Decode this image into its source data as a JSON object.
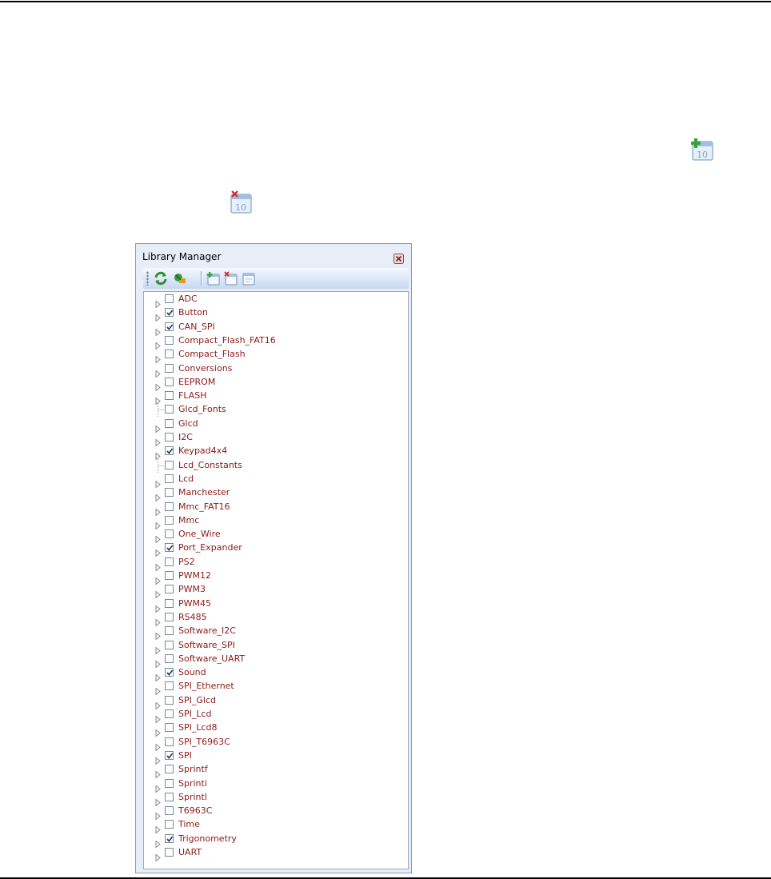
{
  "window": {
    "title": "Library Manager"
  },
  "toolbar": {
    "buttons": [
      {
        "name": "refresh-icon"
      },
      {
        "name": "rebuild-icon"
      },
      {
        "name": "check-all-icon"
      },
      {
        "name": "clear-all-icon"
      },
      {
        "name": "restore-default-icon"
      }
    ]
  },
  "page_icons": [
    {
      "name": "check-all-libraries-icon"
    },
    {
      "name": "clear-all-libraries-icon"
    }
  ],
  "libraries": [
    {
      "label": "ADC",
      "checked": false,
      "expandable": true
    },
    {
      "label": "Button",
      "checked": true,
      "expandable": true
    },
    {
      "label": "CAN_SPI",
      "checked": true,
      "expandable": true
    },
    {
      "label": "Compact_Flash_FAT16",
      "checked": false,
      "expandable": true
    },
    {
      "label": "Compact_Flash",
      "checked": false,
      "expandable": true
    },
    {
      "label": "Conversions",
      "checked": false,
      "expandable": true
    },
    {
      "label": "EEPROM",
      "checked": false,
      "expandable": true
    },
    {
      "label": "FLASH",
      "checked": false,
      "expandable": true
    },
    {
      "label": "Glcd_Fonts",
      "checked": false,
      "expandable": false
    },
    {
      "label": "Glcd",
      "checked": false,
      "expandable": true
    },
    {
      "label": "I2C",
      "checked": false,
      "expandable": true
    },
    {
      "label": "Keypad4x4",
      "checked": true,
      "expandable": true
    },
    {
      "label": "Lcd_Constants",
      "checked": false,
      "expandable": false
    },
    {
      "label": "Lcd",
      "checked": false,
      "expandable": true
    },
    {
      "label": "Manchester",
      "checked": false,
      "expandable": true
    },
    {
      "label": "Mmc_FAT16",
      "checked": false,
      "expandable": true
    },
    {
      "label": "Mmc",
      "checked": false,
      "expandable": true
    },
    {
      "label": "One_Wire",
      "checked": false,
      "expandable": true
    },
    {
      "label": "Port_Expander",
      "checked": true,
      "expandable": true
    },
    {
      "label": "PS2",
      "checked": false,
      "expandable": true
    },
    {
      "label": "PWM12",
      "checked": false,
      "expandable": true
    },
    {
      "label": "PWM3",
      "checked": false,
      "expandable": true
    },
    {
      "label": "PWM45",
      "checked": false,
      "expandable": true
    },
    {
      "label": "RS485",
      "checked": false,
      "expandable": true
    },
    {
      "label": "Software_I2C",
      "checked": false,
      "expandable": true
    },
    {
      "label": "Software_SPI",
      "checked": false,
      "expandable": true
    },
    {
      "label": "Software_UART",
      "checked": false,
      "expandable": true
    },
    {
      "label": "Sound",
      "checked": true,
      "expandable": true
    },
    {
      "label": "SPI_Ethernet",
      "checked": false,
      "expandable": true
    },
    {
      "label": "SPI_Glcd",
      "checked": false,
      "expandable": true
    },
    {
      "label": "SPI_Lcd",
      "checked": false,
      "expandable": true
    },
    {
      "label": "SPI_Lcd8",
      "checked": false,
      "expandable": true
    },
    {
      "label": "SPI_T6963C",
      "checked": false,
      "expandable": true
    },
    {
      "label": "SPI",
      "checked": true,
      "expandable": true
    },
    {
      "label": "Sprintf",
      "checked": false,
      "expandable": true
    },
    {
      "label": "Sprinti",
      "checked": false,
      "expandable": true
    },
    {
      "label": "Sprintl",
      "checked": false,
      "expandable": true
    },
    {
      "label": "T6963C",
      "checked": false,
      "expandable": true
    },
    {
      "label": "Time",
      "checked": false,
      "expandable": true
    },
    {
      "label": "Trigonometry",
      "checked": true,
      "expandable": true
    },
    {
      "label": "UART",
      "checked": false,
      "expandable": true
    }
  ],
  "colors": {
    "label_text": "#8b1a1a",
    "window_bg": "#e8eef8",
    "toolbar_top": "#f4f8ff",
    "toolbar_bottom": "#c8d8f2",
    "check_mark": "#1e3c78"
  }
}
